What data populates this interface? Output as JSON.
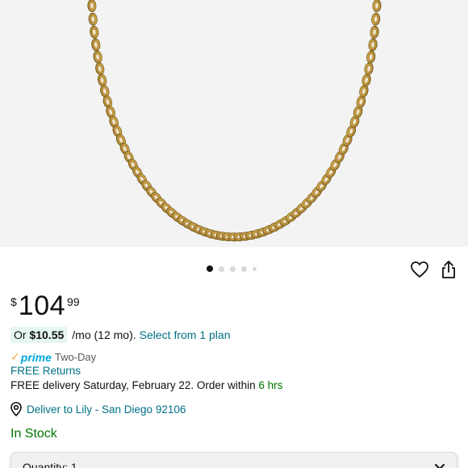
{
  "product": {
    "image_alt": "Gold curb chain necklace",
    "image_count": 5,
    "active_image": 0
  },
  "actions": {
    "favorite_icon": "heart-icon",
    "share_icon": "share-icon"
  },
  "price": {
    "symbol": "$",
    "whole": "104",
    "fraction": "99"
  },
  "installment": {
    "prefix": "Or ",
    "amount": "$10.55",
    "terms": "/mo (12 mo).",
    "link": "Select from 1 plan"
  },
  "shipping": {
    "prime_check": "✓",
    "prime_label": "prime",
    "speed": "Two-Day",
    "returns": "FREE Returns",
    "delivery_text": "FREE delivery Saturday, February 22. Order within ",
    "delivery_time": "6 hrs"
  },
  "location": {
    "icon": "location-pin-icon",
    "label": "Deliver to Lily - San Diego 92106"
  },
  "stock": {
    "status": "In Stock"
  },
  "quantity": {
    "label": "Quantity: 1"
  },
  "colors": {
    "link": "#007185",
    "in_stock": "#007600",
    "prime": "#00a8e1",
    "gold_chain": "#c9a24a"
  }
}
